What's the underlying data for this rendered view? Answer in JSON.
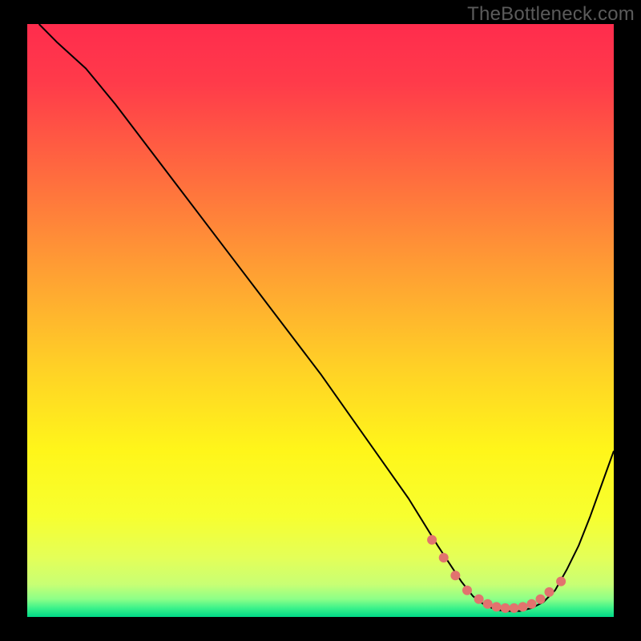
{
  "watermark": "TheBottleneck.com",
  "chart_data": {
    "type": "line",
    "title": "",
    "xlabel": "",
    "ylabel": "",
    "xlim": [
      0,
      100
    ],
    "ylim": [
      0,
      100
    ],
    "series": [
      {
        "name": "bottleneck-curve",
        "x": [
          2,
          5,
          10,
          15,
          20,
          25,
          30,
          35,
          40,
          45,
          50,
          55,
          60,
          65,
          70,
          72,
          74,
          76,
          78,
          80,
          82,
          84,
          86,
          88,
          90,
          92,
          94,
          96,
          98,
          100
        ],
        "y": [
          100,
          97,
          92.5,
          86.5,
          80,
          73.5,
          67,
          60.5,
          54,
          47.5,
          41,
          34,
          27,
          20,
          12,
          9,
          6,
          3.5,
          2,
          1.2,
          1,
          1,
          1.5,
          2.5,
          4.5,
          8,
          12,
          17,
          22.5,
          28
        ]
      }
    ],
    "markers": {
      "name": "highlight-points",
      "color": "#e2736e",
      "x": [
        69,
        71,
        73,
        75,
        77,
        78.5,
        80,
        81.5,
        83,
        84.5,
        86,
        87.5,
        89,
        91
      ],
      "y": [
        13,
        10,
        7,
        4.5,
        3,
        2.2,
        1.7,
        1.5,
        1.5,
        1.7,
        2.2,
        3,
        4.2,
        6
      ]
    },
    "gradient_stops": [
      {
        "offset": 0.0,
        "color": "#ff2c4d"
      },
      {
        "offset": 0.1,
        "color": "#ff3b4a"
      },
      {
        "offset": 0.25,
        "color": "#ff6a3f"
      },
      {
        "offset": 0.42,
        "color": "#ffa033"
      },
      {
        "offset": 0.58,
        "color": "#ffd126"
      },
      {
        "offset": 0.72,
        "color": "#fff61a"
      },
      {
        "offset": 0.83,
        "color": "#f7ff2f"
      },
      {
        "offset": 0.9,
        "color": "#e4ff58"
      },
      {
        "offset": 0.945,
        "color": "#c8ff74"
      },
      {
        "offset": 0.97,
        "color": "#8cff88"
      },
      {
        "offset": 0.985,
        "color": "#3cf28a"
      },
      {
        "offset": 1.0,
        "color": "#00d887"
      }
    ]
  }
}
